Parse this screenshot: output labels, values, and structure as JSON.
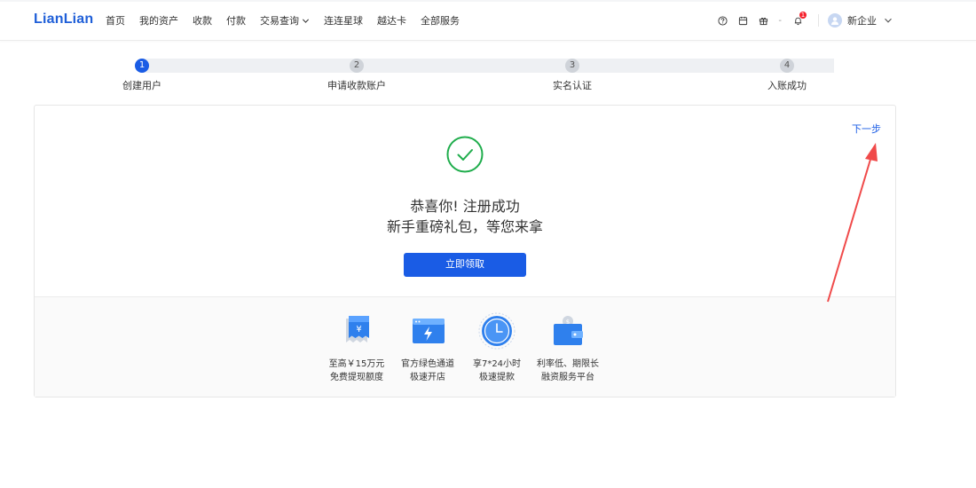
{
  "brand": {
    "logo": "LianLian",
    "accent": "#1a5ce5"
  },
  "nav": {
    "items": [
      {
        "label": "首页"
      },
      {
        "label": "我的资产"
      },
      {
        "label": "收款"
      },
      {
        "label": "付款"
      },
      {
        "label": "交易查询",
        "has_dropdown": true
      },
      {
        "label": "连连星球"
      },
      {
        "label": "越达卡"
      },
      {
        "label": "全部服务"
      }
    ]
  },
  "toolbar": {
    "help_icon": "question-circle-icon",
    "calendar_icon": "calendar-icon",
    "gift_icon": "gift-icon",
    "separator": "-",
    "notification_icon": "bell-icon",
    "notification_count": "1"
  },
  "user": {
    "name": "新企业",
    "avatar_icon": "user-icon"
  },
  "steps": [
    {
      "number": "1",
      "label": "创建用户",
      "active": true
    },
    {
      "number": "2",
      "label": "申请收款账户",
      "active": false
    },
    {
      "number": "3",
      "label": "实名认证",
      "active": false
    },
    {
      "number": "4",
      "label": "入账成功",
      "active": false
    }
  ],
  "success": {
    "next_label": "下一步",
    "title_line1": "恭喜你! 注册成功",
    "title_line2": "新手重磅礼包，等您来拿",
    "claim_label": "立即领取",
    "status_color": "#1fad4c"
  },
  "benefits": [
    {
      "icon": "yuan-receipt-icon",
      "line1": "至高￥15万元",
      "line2": "免费提现额度"
    },
    {
      "icon": "lightning-window-icon",
      "line1": "官方绿色通道",
      "line2": "极速开店"
    },
    {
      "icon": "clock-icon",
      "line1": "享7*24小时",
      "line2": "极速提款"
    },
    {
      "icon": "wallet-icon",
      "line1": "利率低、期限长",
      "line2": "融资服务平台"
    }
  ]
}
